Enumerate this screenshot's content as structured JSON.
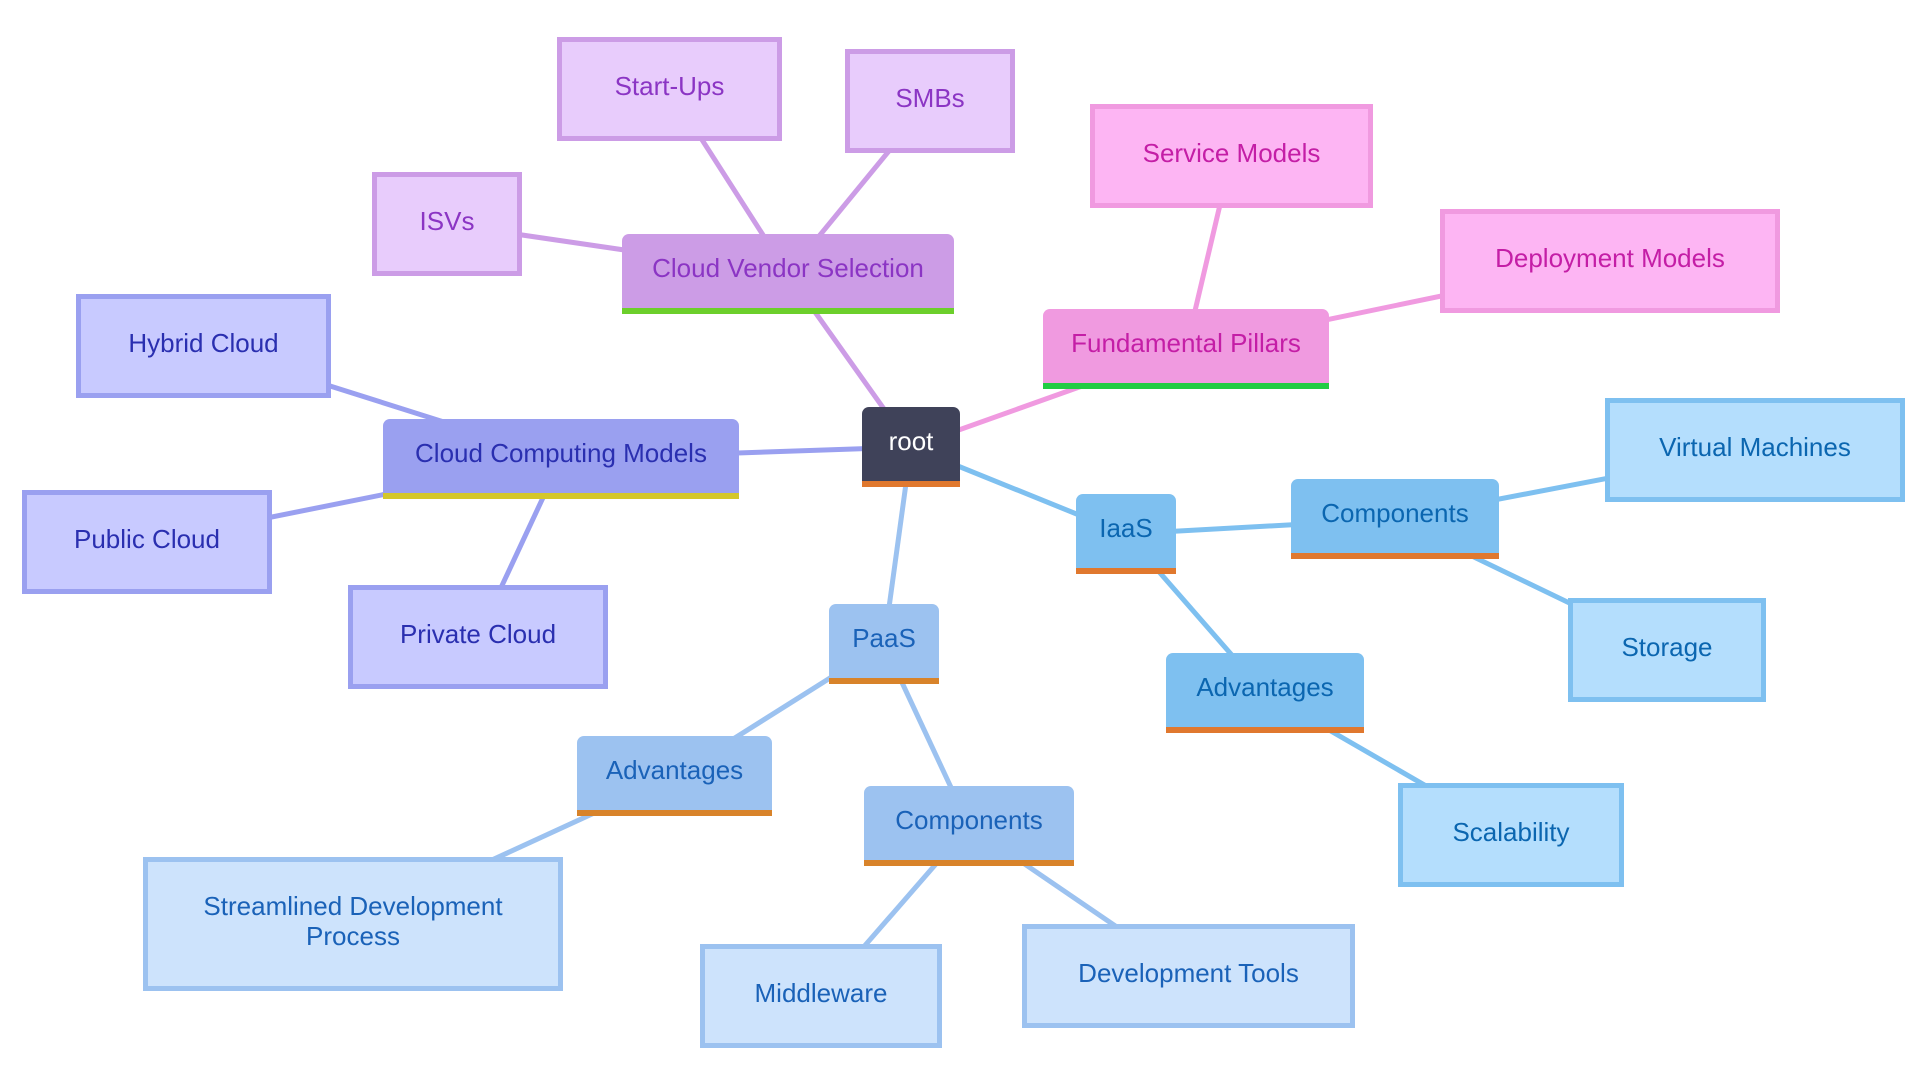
{
  "diagram": {
    "type": "mindmap",
    "root": {
      "id": "root",
      "label": "root",
      "fill": "#3f4259",
      "text": "#ffffff",
      "bar": "#e0782e"
    },
    "colors": {
      "vendor": {
        "line": "#cc9ce6",
        "mid_fill": "#cc9ce6",
        "leaf_fill": "#e8ccfc",
        "leaf_border": "#cc9ce6",
        "text": "#8b35c4",
        "bar": "#6ccf2b"
      },
      "pillars": {
        "line": "#f09ae0",
        "mid_fill": "#f09ae0",
        "leaf_fill": "#fdb5f3",
        "leaf_border": "#f09ae0",
        "text": "#c41ea6",
        "bar": "#22cc44"
      },
      "models": {
        "line": "#9aa0f0",
        "mid_fill": "#9aa0f0",
        "leaf_fill": "#c8caff",
        "leaf_border": "#9aa0f0",
        "text": "#2a2fb0",
        "bar": "#d4c72a"
      },
      "iaas": {
        "line": "#7ec0f0",
        "mid_fill": "#7ec0f0",
        "leaf_fill": "#b4defd",
        "leaf_border": "#7ec0f0",
        "text": "#0b66b0",
        "bar": "#e0782e"
      },
      "paas": {
        "line": "#9cc2f0",
        "mid_fill": "#9cc2f0",
        "leaf_fill": "#cde3fc",
        "leaf_border": "#9cc2f0",
        "text": "#1a62b8",
        "bar": "#d8832a"
      }
    },
    "nodes": [
      {
        "id": "vendor",
        "label": "Cloud Vendor Selection",
        "parent": "root",
        "group": "vendor",
        "kind": "mid"
      },
      {
        "id": "startups",
        "label": "Start-Ups",
        "parent": "vendor",
        "group": "vendor",
        "kind": "leaf"
      },
      {
        "id": "smbs",
        "label": "SMBs",
        "parent": "vendor",
        "group": "vendor",
        "kind": "leaf"
      },
      {
        "id": "isvs",
        "label": "ISVs",
        "parent": "vendor",
        "group": "vendor",
        "kind": "leaf"
      },
      {
        "id": "pillars",
        "label": "Fundamental Pillars",
        "parent": "root",
        "group": "pillars",
        "kind": "mid"
      },
      {
        "id": "service",
        "label": "Service Models",
        "parent": "pillars",
        "group": "pillars",
        "kind": "leaf"
      },
      {
        "id": "deploy",
        "label": "Deployment Models",
        "parent": "pillars",
        "group": "pillars",
        "kind": "leaf"
      },
      {
        "id": "models",
        "label": "Cloud Computing Models",
        "parent": "root",
        "group": "models",
        "kind": "mid"
      },
      {
        "id": "hybrid",
        "label": "Hybrid Cloud",
        "parent": "models",
        "group": "models",
        "kind": "leaf"
      },
      {
        "id": "public",
        "label": "Public Cloud",
        "parent": "models",
        "group": "models",
        "kind": "leaf"
      },
      {
        "id": "private",
        "label": "Private Cloud",
        "parent": "models",
        "group": "models",
        "kind": "leaf"
      },
      {
        "id": "iaas",
        "label": "IaaS",
        "parent": "root",
        "group": "iaas",
        "kind": "mid"
      },
      {
        "id": "iaas_comp",
        "label": "Components",
        "parent": "iaas",
        "group": "iaas",
        "kind": "mid"
      },
      {
        "id": "vm",
        "label": "Virtual Machines",
        "parent": "iaas_comp",
        "group": "iaas",
        "kind": "leaf"
      },
      {
        "id": "storage",
        "label": "Storage",
        "parent": "iaas_comp",
        "group": "iaas",
        "kind": "leaf"
      },
      {
        "id": "iaas_adv",
        "label": "Advantages",
        "parent": "iaas",
        "group": "iaas",
        "kind": "mid"
      },
      {
        "id": "scal",
        "label": "Scalability",
        "parent": "iaas_adv",
        "group": "iaas",
        "kind": "leaf"
      },
      {
        "id": "paas",
        "label": "PaaS",
        "parent": "root",
        "group": "paas",
        "kind": "mid"
      },
      {
        "id": "paas_adv",
        "label": "Advantages",
        "parent": "paas",
        "group": "paas",
        "kind": "mid"
      },
      {
        "id": "stream",
        "label": "Streamlined Development Process",
        "parent": "paas_adv",
        "group": "paas",
        "kind": "leaf"
      },
      {
        "id": "paas_comp",
        "label": "Components",
        "parent": "paas",
        "group": "paas",
        "kind": "mid"
      },
      {
        "id": "middleware",
        "label": "Middleware",
        "parent": "paas_comp",
        "group": "paas",
        "kind": "leaf"
      },
      {
        "id": "devtools",
        "label": "Development Tools",
        "parent": "paas_comp",
        "group": "paas",
        "kind": "leaf"
      }
    ]
  }
}
